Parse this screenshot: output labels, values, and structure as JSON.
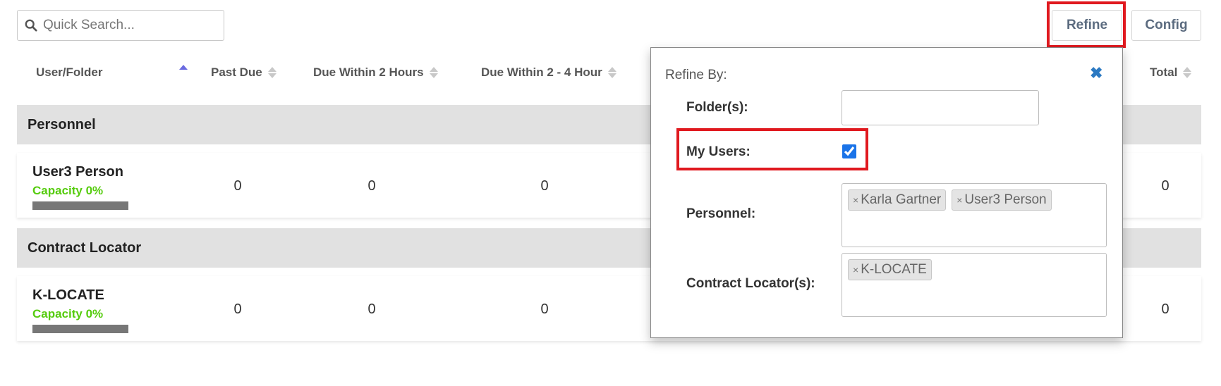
{
  "search": {
    "placeholder": "Quick Search..."
  },
  "toolbar": {
    "refine_label": "Refine",
    "config_label": "Config"
  },
  "table": {
    "headers": {
      "user_folder": "User/Folder",
      "past_due": "Past Due",
      "due_2h": "Due Within 2 Hours",
      "due_2_4h": "Due Within 2 - 4 Hour",
      "total": "Total"
    },
    "groups": [
      {
        "name": "Personnel",
        "rows": [
          {
            "name": "User3 Person",
            "capacity": "Capacity 0%",
            "past_due": "0",
            "due_2h": "0",
            "due_2_4h": "0",
            "total": "0"
          }
        ]
      },
      {
        "name": "Contract Locator",
        "rows": [
          {
            "name": "K-LOCATE",
            "capacity": "Capacity 0%",
            "past_due": "0",
            "due_2h": "0",
            "due_2_4h": "0",
            "total": "0"
          }
        ]
      }
    ]
  },
  "refine_panel": {
    "title": "Refine By:",
    "close_glyph": "✖",
    "folders_label": "Folder(s):",
    "folders_value": "",
    "my_users_label": "My Users:",
    "my_users_checked": true,
    "personnel_label": "Personnel:",
    "personnel_tags": [
      "Karla Gartner",
      "User3 Person"
    ],
    "contract_locators_label": "Contract Locator(s):",
    "contract_locator_tags": [
      "K-LOCATE"
    ],
    "tag_remove_glyph": "×"
  },
  "colors": {
    "highlight": "#e0191f",
    "capacity_green": "#56cc0f",
    "sort_active": "#6a6ae0",
    "close_blue": "#2b79c2",
    "group_bg": "#e1e1e1"
  },
  "icons": {
    "search": "search-icon",
    "close": "close-icon",
    "sort": "sort-icon"
  }
}
